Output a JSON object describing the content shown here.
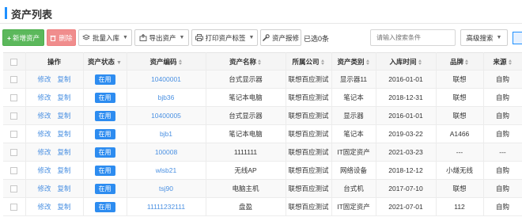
{
  "title": "资产列表",
  "toolbar": {
    "add": "新增资产",
    "delete": "删除",
    "batch_import": "批量入库",
    "export": "导出资产",
    "print_tag": "打印资产标签",
    "repair": "资产报修",
    "selected_count": "已选0条",
    "search_placeholder": "请输入搜索条件",
    "advanced_search": "高级搜索"
  },
  "columns": [
    "操作",
    "资产状态",
    "资产编码",
    "资产名称",
    "所属公司",
    "资产类别",
    "入库时间",
    "品牌",
    "来源"
  ],
  "actions": {
    "edit": "修改",
    "copy": "复制"
  },
  "rows": [
    {
      "status": "在用",
      "code": "10400001",
      "name": "台式显示器",
      "company": "联想百应测试",
      "category": "显示器11",
      "date": "2016-01-01",
      "brand": "联想",
      "source": "自购"
    },
    {
      "status": "在用",
      "code": "bjb36",
      "name": "笔记本电脑",
      "company": "联想百应测试",
      "category": "笔记本",
      "date": "2018-12-31",
      "brand": "联想",
      "source": "自购"
    },
    {
      "status": "在用",
      "code": "10400005",
      "name": "台式显示器",
      "company": "联想百应测试",
      "category": "显示器",
      "date": "2016-01-01",
      "brand": "联想",
      "source": "自购"
    },
    {
      "status": "在用",
      "code": "bjb1",
      "name": "笔记本电脑",
      "company": "联想百应测试",
      "category": "笔记本",
      "date": "2019-03-22",
      "brand": "A1466",
      "source": "自购"
    },
    {
      "status": "在用",
      "code": "100008",
      "name": "1111111",
      "company": "联想百应测试",
      "category": "IT固定资产",
      "date": "2021-03-23",
      "brand": "---",
      "source": "---"
    },
    {
      "status": "在用",
      "code": "wlsb21",
      "name": "无线AP",
      "company": "联想百应测试",
      "category": "网络设备",
      "date": "2018-12-12",
      "brand": "小燧无线",
      "source": "自购"
    },
    {
      "status": "在用",
      "code": "tsj90",
      "name": "电脑主机",
      "company": "联想百应测试",
      "category": "台式机",
      "date": "2017-07-10",
      "brand": "联想",
      "source": "自购"
    },
    {
      "status": "在用",
      "code": "11111232111",
      "name": "盘盈",
      "company": "联想百应测试",
      "category": "IT固定资产",
      "date": "2021-07-01",
      "brand": "112",
      "source": "自购"
    }
  ],
  "colors": {
    "accent": "#1e90ff",
    "add_green": "#5cb85c",
    "delete_red": "#f08d8d",
    "badge_blue": "#2d8cf0",
    "link": "#4a90e2"
  }
}
